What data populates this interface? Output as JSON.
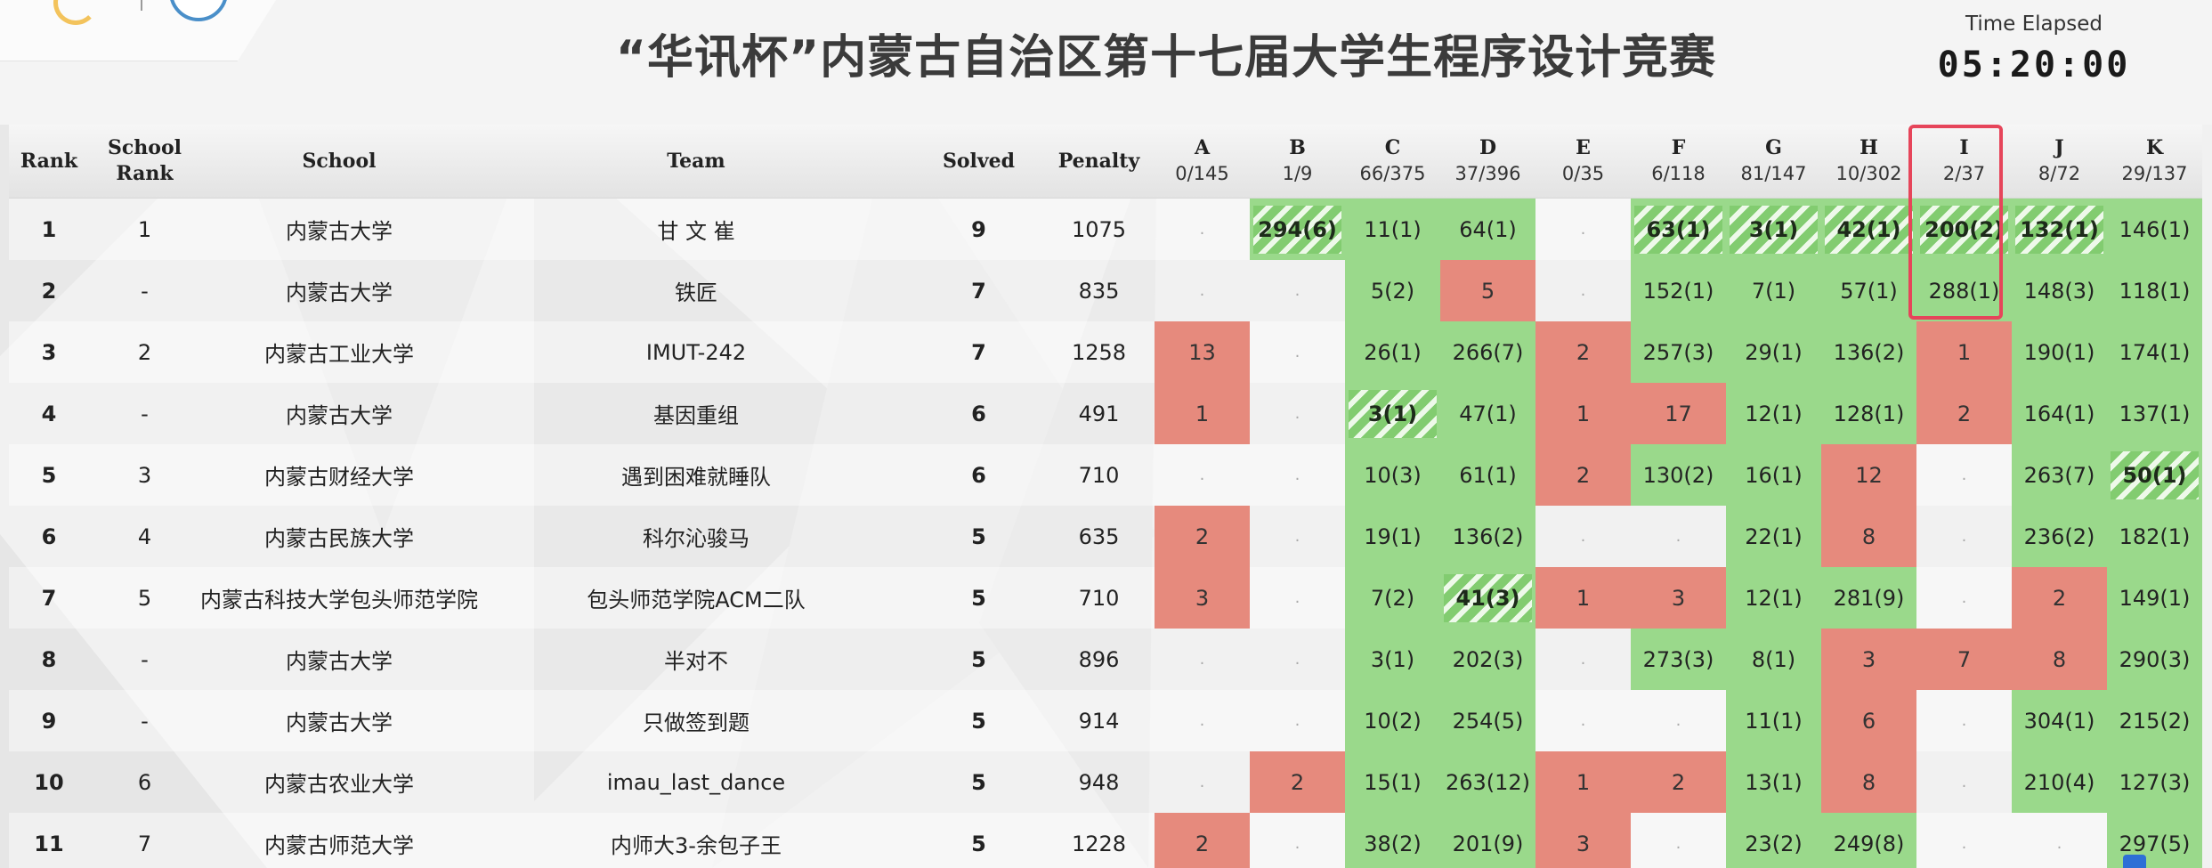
{
  "header": {
    "title": "“华讯杯”内蒙古自治区第十七届大学生程序设计竞赛",
    "time_label": "Time Elapsed",
    "time_value": "05:20:00"
  },
  "columns": {
    "rank": "Rank",
    "school_rank_line1": "School",
    "school_rank_line2": "Rank",
    "school": "School",
    "team": "Team",
    "solved": "Solved",
    "penalty": "Penalty"
  },
  "problems": [
    {
      "id": "A",
      "stat": "0/145"
    },
    {
      "id": "B",
      "stat": "1/9"
    },
    {
      "id": "C",
      "stat": "66/375"
    },
    {
      "id": "D",
      "stat": "37/396"
    },
    {
      "id": "E",
      "stat": "0/35"
    },
    {
      "id": "F",
      "stat": "6/118"
    },
    {
      "id": "G",
      "stat": "81/147"
    },
    {
      "id": "H",
      "stat": "10/302"
    },
    {
      "id": "I",
      "stat": "2/37"
    },
    {
      "id": "J",
      "stat": "8/72"
    },
    {
      "id": "K",
      "stat": "29/137"
    }
  ],
  "rows": [
    {
      "rank": "1",
      "school_rank": "1",
      "school": "内蒙古大学",
      "team": "甘 文 崔",
      "solved": "9",
      "penalty": "1075",
      "cells": [
        [
          "e",
          "."
        ],
        [
          "fb",
          "294(6)"
        ],
        [
          "ac",
          "11(1)"
        ],
        [
          "ac",
          "64(1)"
        ],
        [
          "e",
          "."
        ],
        [
          "fb",
          "63(1)"
        ],
        [
          "fb",
          "3(1)"
        ],
        [
          "fb",
          "42(1)"
        ],
        [
          "fb",
          "200(2)"
        ],
        [
          "fb",
          "132(1)"
        ],
        [
          "ac",
          "146(1)"
        ]
      ]
    },
    {
      "rank": "2",
      "school_rank": "-",
      "school": "内蒙古大学",
      "team": "铁匠",
      "solved": "7",
      "penalty": "835",
      "cells": [
        [
          "e",
          "."
        ],
        [
          "e",
          "."
        ],
        [
          "ac",
          "5(2)"
        ],
        [
          "wa",
          "5"
        ],
        [
          "e",
          "."
        ],
        [
          "ac",
          "152(1)"
        ],
        [
          "ac",
          "7(1)"
        ],
        [
          "ac",
          "57(1)"
        ],
        [
          "ac",
          "288(1)"
        ],
        [
          "ac",
          "148(3)"
        ],
        [
          "ac",
          "118(1)"
        ]
      ]
    },
    {
      "rank": "3",
      "school_rank": "2",
      "school": "内蒙古工业大学",
      "team": "IMUT-242",
      "solved": "7",
      "penalty": "1258",
      "cells": [
        [
          "wa",
          "13"
        ],
        [
          "e",
          "."
        ],
        [
          "ac",
          "26(1)"
        ],
        [
          "ac",
          "266(7)"
        ],
        [
          "wa",
          "2"
        ],
        [
          "ac",
          "257(3)"
        ],
        [
          "ac",
          "29(1)"
        ],
        [
          "ac",
          "136(2)"
        ],
        [
          "wa",
          "1"
        ],
        [
          "ac",
          "190(1)"
        ],
        [
          "ac",
          "174(1)"
        ]
      ]
    },
    {
      "rank": "4",
      "school_rank": "-",
      "school": "内蒙古大学",
      "team": "基因重组",
      "solved": "6",
      "penalty": "491",
      "cells": [
        [
          "wa",
          "1"
        ],
        [
          "e",
          "."
        ],
        [
          "fb",
          "3(1)"
        ],
        [
          "ac",
          "47(1)"
        ],
        [
          "wa",
          "1"
        ],
        [
          "wa",
          "17"
        ],
        [
          "ac",
          "12(1)"
        ],
        [
          "ac",
          "128(1)"
        ],
        [
          "wa",
          "2"
        ],
        [
          "ac",
          "164(1)"
        ],
        [
          "ac",
          "137(1)"
        ]
      ]
    },
    {
      "rank": "5",
      "school_rank": "3",
      "school": "内蒙古财经大学",
      "team": "遇到困难就睡队",
      "solved": "6",
      "penalty": "710",
      "cells": [
        [
          "e",
          "."
        ],
        [
          "e",
          "."
        ],
        [
          "ac",
          "10(3)"
        ],
        [
          "ac",
          "61(1)"
        ],
        [
          "wa",
          "2"
        ],
        [
          "ac",
          "130(2)"
        ],
        [
          "ac",
          "16(1)"
        ],
        [
          "wa",
          "12"
        ],
        [
          "e",
          "."
        ],
        [
          "ac",
          "263(7)"
        ],
        [
          "fb",
          "50(1)"
        ]
      ]
    },
    {
      "rank": "6",
      "school_rank": "4",
      "school": "内蒙古民族大学",
      "team": "科尔沁骏马",
      "solved": "5",
      "penalty": "635",
      "cells": [
        [
          "wa",
          "2"
        ],
        [
          "e",
          "."
        ],
        [
          "ac",
          "19(1)"
        ],
        [
          "ac",
          "136(2)"
        ],
        [
          "e",
          "."
        ],
        [
          "e",
          "."
        ],
        [
          "ac",
          "22(1)"
        ],
        [
          "wa",
          "8"
        ],
        [
          "e",
          "."
        ],
        [
          "ac",
          "236(2)"
        ],
        [
          "ac",
          "182(1)"
        ]
      ]
    },
    {
      "rank": "7",
      "school_rank": "5",
      "school": "内蒙古科技大学包头师范学院",
      "team": "包头师范学院ACM二队",
      "solved": "5",
      "penalty": "710",
      "cells": [
        [
          "wa",
          "3"
        ],
        [
          "e",
          "."
        ],
        [
          "ac",
          "7(2)"
        ],
        [
          "fb",
          "41(3)"
        ],
        [
          "wa",
          "1"
        ],
        [
          "wa",
          "3"
        ],
        [
          "ac",
          "12(1)"
        ],
        [
          "ac",
          "281(9)"
        ],
        [
          "e",
          "."
        ],
        [
          "wa",
          "2"
        ],
        [
          "ac",
          "149(1)"
        ]
      ]
    },
    {
      "rank": "8",
      "school_rank": "-",
      "school": "内蒙古大学",
      "team": "半对不",
      "solved": "5",
      "penalty": "896",
      "cells": [
        [
          "e",
          "."
        ],
        [
          "e",
          "."
        ],
        [
          "ac",
          "3(1)"
        ],
        [
          "ac",
          "202(3)"
        ],
        [
          "e",
          "."
        ],
        [
          "ac",
          "273(3)"
        ],
        [
          "ac",
          "8(1)"
        ],
        [
          "wa",
          "3"
        ],
        [
          "wa",
          "7"
        ],
        [
          "wa",
          "8"
        ],
        [
          "ac",
          "290(3)"
        ]
      ]
    },
    {
      "rank": "9",
      "school_rank": "-",
      "school": "内蒙古大学",
      "team": "只做签到题",
      "solved": "5",
      "penalty": "914",
      "cells": [
        [
          "e",
          "."
        ],
        [
          "e",
          "."
        ],
        [
          "ac",
          "10(2)"
        ],
        [
          "ac",
          "254(5)"
        ],
        [
          "e",
          "."
        ],
        [
          "e",
          "."
        ],
        [
          "ac",
          "11(1)"
        ],
        [
          "wa",
          "6"
        ],
        [
          "e",
          "."
        ],
        [
          "ac",
          "304(1)"
        ],
        [
          "ac",
          "215(2)"
        ]
      ]
    },
    {
      "rank": "10",
      "school_rank": "6",
      "school": "内蒙古农业大学",
      "team": "imau_last_dance",
      "solved": "5",
      "penalty": "948",
      "cells": [
        [
          "e",
          "."
        ],
        [
          "wa",
          "2"
        ],
        [
          "ac",
          "15(1)"
        ],
        [
          "ac",
          "263(12)"
        ],
        [
          "wa",
          "1"
        ],
        [
          "wa",
          "2"
        ],
        [
          "ac",
          "13(1)"
        ],
        [
          "wa",
          "8"
        ],
        [
          "e",
          "."
        ],
        [
          "ac",
          "210(4)"
        ],
        [
          "ac",
          "127(3)"
        ]
      ]
    },
    {
      "rank": "11",
      "school_rank": "7",
      "school": "内蒙古师范大学",
      "team": "内师大3-余包子王",
      "solved": "5",
      "penalty": "1228",
      "cells": [
        [
          "wa",
          "2"
        ],
        [
          "e",
          "."
        ],
        [
          "ac",
          "38(2)"
        ],
        [
          "ac",
          "201(9)"
        ],
        [
          "wa",
          "3"
        ],
        [
          "e",
          "."
        ],
        [
          "ac",
          "23(2)"
        ],
        [
          "ac",
          "249(8)"
        ],
        [
          "e",
          "."
        ],
        [
          "e",
          "."
        ],
        [
          "ac",
          "297(5)"
        ]
      ]
    }
  ],
  "colors": {
    "accepted": "#9ad98b",
    "rejected": "#e68a7d",
    "first_blood_stripe": "#82cc70",
    "highlight_box": "#e6455a"
  }
}
